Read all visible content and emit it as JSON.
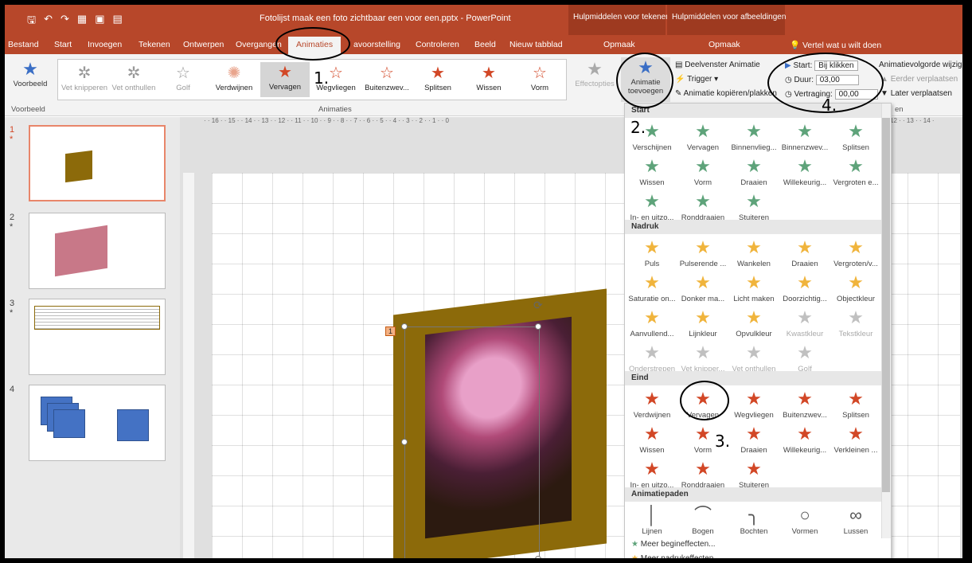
{
  "titlebar": {
    "doc_title": "Fotolijst maak een foto zichtbaar een voor een.pptx - PowerPoint",
    "context_draw": "Hulpmiddelen voor tekenen",
    "context_picture": "Hulpmiddelen voor afbeeldingen",
    "bg": "#b7472a"
  },
  "tabs": [
    "Bestand",
    "Start",
    "Invoegen",
    "Tekenen",
    "Ontwerpen",
    "Overgangen",
    "Animaties",
    "avoorstelling",
    "Controleren",
    "Beeld",
    "Nieuw tabblad",
    "Opmaak",
    "Opmaak"
  ],
  "search_text": "Vertel wat u wilt doen",
  "ribbon": {
    "preview_label": "Voorbeeld",
    "preview_group": "Voorbeeld",
    "gallery": [
      {
        "label": "Vet knipperen",
        "icon": "star-b-icon"
      },
      {
        "label": "Vet onthullen",
        "icon": "star-b-icon"
      },
      {
        "label": "Golf",
        "icon": "star-a-icon"
      },
      {
        "label": "Verdwijnen",
        "icon": "burst-icon"
      },
      {
        "label": "Vervagen",
        "icon": "star-icon"
      },
      {
        "label": "Wegvliegen",
        "icon": "star-fly-icon"
      },
      {
        "label": "Buitenzwev...",
        "icon": "star-icon"
      },
      {
        "label": "Splitsen",
        "icon": "star-icon"
      },
      {
        "label": "Wissen",
        "icon": "star-icon"
      },
      {
        "label": "Vorm",
        "icon": "star-icon"
      }
    ],
    "anim_group": "Animaties",
    "effect_options": "Effectopties",
    "add_animation": "Animatie toevoegen",
    "pane_label": "Deelvenster Animatie",
    "trigger_label": "Trigger",
    "painter_label": "Animatie kopiëren/plakken",
    "start_label": "Start:",
    "start_value": "Bij klikken",
    "duration_label": "Duur:",
    "duration_value": "03,00",
    "delay_label": "Vertraging:",
    "delay_value": "00,00",
    "reorder_label": "Animatievolgorde wijzigen",
    "earlier_label": "Eerder verplaatsen",
    "later_label": "Later verplaatsen",
    "timing_group": "en"
  },
  "slides": [
    {
      "num": "1",
      "star": "*"
    },
    {
      "num": "2",
      "star": "*"
    },
    {
      "num": "3",
      "star": "*"
    },
    {
      "num": "4",
      "star": ""
    }
  ],
  "ruler_text": "· · 16 · · 15 · · 14 · · 13 · · 12 · · 11 · · 10 · · 9 · · 8 · · 7 · · 6 · · 5 · · 4 · · 3 · · 2 · · 1 · · 0",
  "ruler_text_right": "12 · · 13 · · 14 ·",
  "anim_tag": "1",
  "dropdown": {
    "start_head": "Start",
    "start": [
      "Verschijnen",
      "Vervagen",
      "Binnenvlieg...",
      "Binnenzwev...",
      "Splitsen",
      "Wissen",
      "Vorm",
      "Draaien",
      "Willekeurig...",
      "Vergroten e...",
      "In- en uitzo...",
      "Ronddraaien",
      "Stuiteren"
    ],
    "emph_head": "Nadruk",
    "emph": [
      "Puls",
      "Pulserende ...",
      "Wankelen",
      "Draaien",
      "Vergroten/v...",
      "Saturatie on...",
      "Donker ma...",
      "Licht maken",
      "Doorzichtig...",
      "Objectkleur",
      "Aanvullend...",
      "Lijnkleur",
      "Opvulkleur",
      "Kwastkleur",
      "Tekstkleur",
      "Onderstrepen",
      "Vet knipper...",
      "Vet onthullen",
      "Golf"
    ],
    "exit_head": "Eind",
    "exit": [
      "Verdwijnen",
      "Vervagen",
      "Wegvliegen",
      "Buitenzwev...",
      "Splitsen",
      "Wissen",
      "Vorm",
      "Draaien",
      "Willekeurig...",
      "Verkleinen ...",
      "In- en uitzo...",
      "Ronddraaien",
      "Stuiteren"
    ],
    "path_head": "Animatiepaden",
    "paths": [
      "Lijnen",
      "Bogen",
      "Bochten",
      "Vormen",
      "Lussen"
    ],
    "more_start": "Meer begineffecten...",
    "more_emph": "Meer nadrukeffecten..."
  },
  "annotations": [
    "1.",
    "2.",
    "3.",
    "4."
  ],
  "colors": {
    "start": "#5ea37a",
    "emph": "#f0b43c",
    "exit": "#d24726",
    "accent": "#b7472a"
  }
}
